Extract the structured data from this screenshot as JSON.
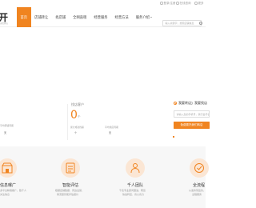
{
  "topbar": {
    "phone": "登录/注册",
    "service": "在线咨询",
    "more": "更多"
  },
  "header": {
    "logo": "开",
    "logo_sub": "无忧开店",
    "nav": [
      {
        "label": "首页",
        "active": true
      },
      {
        "label": "店铺转让",
        "active": false
      },
      {
        "label": "找店铺",
        "active": false
      },
      {
        "label": "全网直租",
        "active": false
      },
      {
        "label": "经营服务",
        "active": false
      },
      {
        "label": "经营方法",
        "active": false
      },
      {
        "label": "服务介绍",
        "active": false,
        "has_caret": true
      }
    ],
    "search_placeholder": "输入关键字，搜索店铺信息"
  },
  "stats": {
    "left_label_1": "平均转铺周期",
    "left_value_1": "天",
    "col2_title": "找店客户",
    "col2_number": "0",
    "col2_unit": "个",
    "col2_label_1": "累计成功找铺",
    "col2_value_1": "个",
    "col2_label_2": "平均找店周期",
    "col2_value_2": "天"
  },
  "form": {
    "tab_1": "我要转店",
    "tab_2": "我要找店",
    "phone_placeholder": "请输入您的手机号，我们会尽快联系您",
    "submit_label": "免费委托我们转店"
  },
  "features": [
    {
      "icon": "shop-icon",
      "title": "信息曝广",
      "desc_1": "多平台精准推广，数千人",
      "desc_2": "关注信息"
    },
    {
      "icon": "assessment-icon",
      "title": "智能评估",
      "desc_1": "根据店铺数据、周边设施、",
      "desc_2": "客流量智能评估报价"
    },
    {
      "icon": "team-icon",
      "title": "千人团队",
      "desc_1": "千名专业顾问跟进，帮您",
      "desc_2": "快速转店、省心省力"
    },
    {
      "icon": "process-icon",
      "title": "全流程",
      "desc_1": "从发布到签约，",
      "desc_2": "全程服务"
    }
  ],
  "colors": {
    "accent": "#f08420",
    "icon_bg": "#fbe6d4",
    "section_bg": "#f7f7f7"
  }
}
